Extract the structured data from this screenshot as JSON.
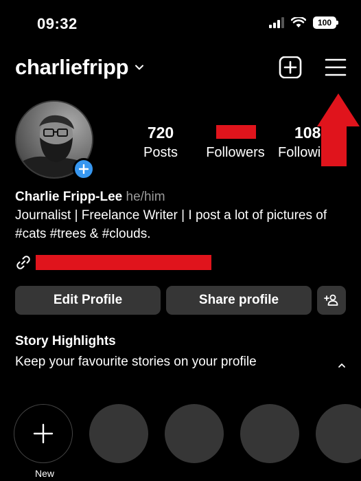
{
  "status": {
    "time": "09:32",
    "battery": "100"
  },
  "header": {
    "username": "charliefripp"
  },
  "stats": [
    {
      "value": "720",
      "label": "Posts"
    },
    {
      "value": "",
      "label": "Followers"
    },
    {
      "value": "108",
      "label": "Following"
    }
  ],
  "profile": {
    "name": "Charlie Fripp-Lee",
    "pronouns": "he/him",
    "bio": "Journalist | Freelance Writer | I post a lot of pictures of #cats #trees & #clouds."
  },
  "buttons": {
    "edit": "Edit Profile",
    "share": "Share profile"
  },
  "highlights": {
    "title": "Story Highlights",
    "subtitle": "Keep your favourite stories on your profile",
    "new_label": "New"
  },
  "colors": {
    "redaction": "#e0141c",
    "accent_blue": "#3797f0",
    "button_bg": "#363636"
  }
}
